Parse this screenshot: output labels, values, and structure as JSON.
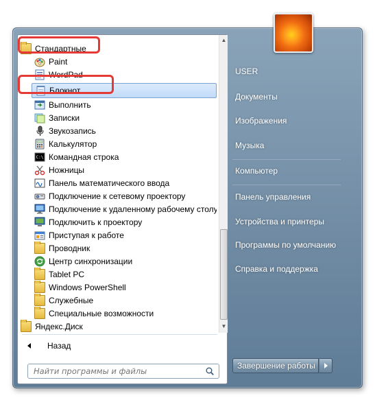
{
  "programs": [
    {
      "label": "Стандартные",
      "icon": "folder-icon"
    },
    {
      "label": "Paint",
      "icon": "paint-icon"
    },
    {
      "label": "WordPad",
      "icon": "wordpad-icon"
    },
    {
      "label": "Блокнот",
      "icon": "notepad-icon"
    },
    {
      "label": "Выполнить",
      "icon": "run-icon"
    },
    {
      "label": "Записки",
      "icon": "sticky-notes-icon"
    },
    {
      "label": "Звукозапись",
      "icon": "microphone-icon"
    },
    {
      "label": "Калькулятор",
      "icon": "calculator-icon"
    },
    {
      "label": "Командная строка",
      "icon": "cmd-icon"
    },
    {
      "label": "Ножницы",
      "icon": "scissors-icon"
    },
    {
      "label": "Панель математического ввода",
      "icon": "math-input-icon"
    },
    {
      "label": "Подключение к сетевому проектору",
      "icon": "network-projector-icon"
    },
    {
      "label": "Подключение к удаленному рабочему столу",
      "icon": "remote-desktop-icon"
    },
    {
      "label": "Подключить к проектору",
      "icon": "projector-icon"
    },
    {
      "label": "Приступая к работе",
      "icon": "getting-started-icon"
    },
    {
      "label": "Проводник",
      "icon": "folder-icon"
    },
    {
      "label": "Центр синхронизации",
      "icon": "sync-center-icon"
    },
    {
      "label": "Tablet PC",
      "icon": "folder-icon"
    },
    {
      "label": "Windows PowerShell",
      "icon": "folder-icon"
    },
    {
      "label": "Служебные",
      "icon": "folder-icon"
    },
    {
      "label": "Специальные возможности",
      "icon": "folder-icon"
    },
    {
      "label": "Яндекс.Диск",
      "icon": "folder-icon"
    }
  ],
  "back_label": "Назад",
  "search_placeholder": "Найти программы и файлы",
  "right_items": [
    "USER",
    "Документы",
    "Изображения",
    "Музыка",
    "Компьютер",
    "Панель управления",
    "Устройства и принтеры",
    "Программы по умолчанию",
    "Справка и поддержка"
  ],
  "shutdown_label": "Завершение работы",
  "colors": {
    "highlight": "#e53935",
    "selection": "#c1dbfa",
    "panel": "#7c97ae"
  }
}
